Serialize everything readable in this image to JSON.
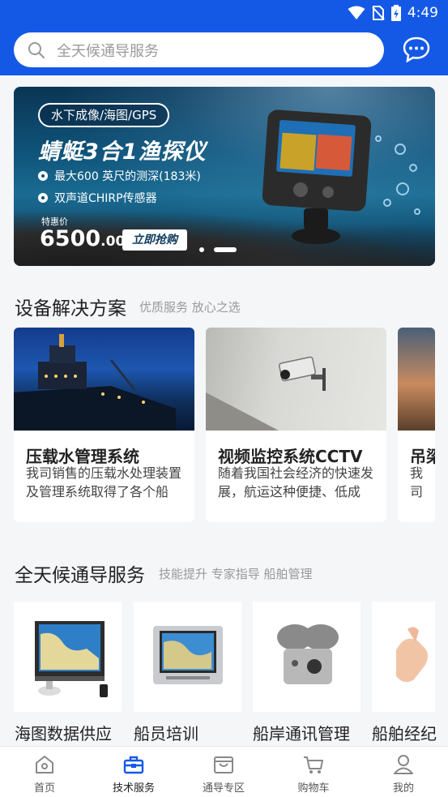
{
  "status_bar": {
    "time": "4:49"
  },
  "search": {
    "placeholder": "全天候通导服务"
  },
  "banner": {
    "tag": "水下成像/海图/GPS",
    "title": "蜻蜓3合1渔探仪",
    "features": [
      "最大600 英尺的测深(183米)",
      "双声道CHIRP传感器"
    ],
    "price_label": "特惠价",
    "price_main": "6500",
    "price_cents": ".00",
    "cta": "立即抢购",
    "slides": 2,
    "active_slide": 1
  },
  "solutions": {
    "title": "设备解决方案",
    "subtitle": "优质服务 放心之选",
    "cards": [
      {
        "title": "压载水管理系统",
        "desc": "我司销售的压载水处理装置及管理系统取得了各个船"
      },
      {
        "title": "视频监控系统CCTV",
        "desc": "随着我国社会经济的快速发展，航运这种便捷、低成"
      },
      {
        "title": "吊梁",
        "desc": "我司梁"
      }
    ]
  },
  "services": {
    "title": "全天候通导服务",
    "subtitle": "技能提升 专家指导 船舶管理",
    "items": [
      {
        "label": "海图数据供应"
      },
      {
        "label": "船员培训"
      },
      {
        "label": "船岸通讯管理"
      },
      {
        "label": "船舶经纪"
      }
    ]
  },
  "bottom_nav": {
    "items": [
      {
        "label": "首页",
        "icon": "home-icon"
      },
      {
        "label": "技术服务",
        "icon": "toolbox-icon"
      },
      {
        "label": "通导专区",
        "icon": "bag-icon"
      },
      {
        "label": "购物车",
        "icon": "cart-icon"
      },
      {
        "label": "我的",
        "icon": "user-icon"
      }
    ],
    "active_index": 1
  },
  "colors": {
    "primary": "#1459e6",
    "active_nav": "#1459e6",
    "background": "#f5f6f8"
  }
}
